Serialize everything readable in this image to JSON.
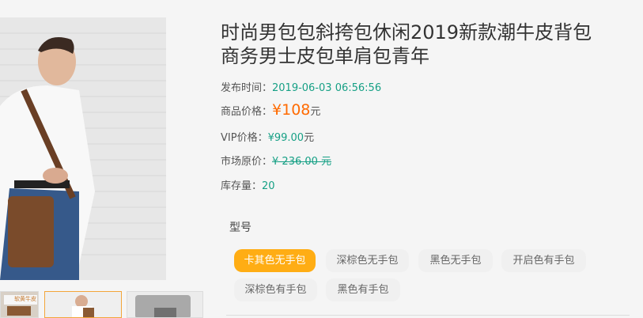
{
  "product": {
    "title_line1": "时尚男包包斜挎包休闲2019新款潮牛皮背包",
    "title_line2": "商务男士皮包单肩包青年",
    "publish_label": "发布时间：",
    "publish_time": "2019-06-03 06:56:56",
    "price_label": "商品价格：",
    "price_value": "¥108",
    "price_unit": "元",
    "vip_label": "VIP价格：",
    "vip_value": "¥99.00",
    "vip_unit": "元",
    "market_label": "市场原价：",
    "market_value": "¥ 236.00 元",
    "stock_label": "库存量：",
    "stock_value": "20"
  },
  "variants": {
    "label": "型号",
    "options": [
      "卡其色无手包",
      "深棕色无手包",
      "黑色无手包",
      "开启色有手包",
      "深棕色有手包",
      "黑色有手包"
    ],
    "selected_index": 0
  },
  "gallery": {
    "thumbnail_caption": "软黄牛皮"
  },
  "colors": {
    "accent_orange": "#ffad14",
    "price_orange": "#ff6a00",
    "value_green": "#16a085"
  }
}
